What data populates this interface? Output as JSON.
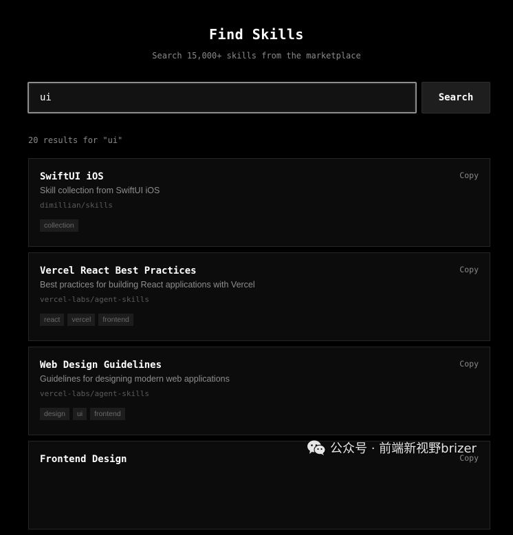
{
  "header": {
    "title": "Find Skills",
    "subtitle": "Search 15,000+ skills from the marketplace"
  },
  "search": {
    "value": "ui",
    "button_label": "Search"
  },
  "results_count": "20 results for \"ui\"",
  "results": [
    {
      "title": "SwiftUI iOS",
      "description": "Skill collection from SwiftUI iOS",
      "repo": "dimillian/skills",
      "tags": [
        "collection"
      ],
      "copy_label": "Copy"
    },
    {
      "title": "Vercel React Best Practices",
      "description": "Best practices for building React applications with Vercel",
      "repo": "vercel-labs/agent-skills",
      "tags": [
        "react",
        "vercel",
        "frontend"
      ],
      "copy_label": "Copy"
    },
    {
      "title": "Web Design Guidelines",
      "description": "Guidelines for designing modern web applications",
      "repo": "vercel-labs/agent-skills",
      "tags": [
        "design",
        "ui",
        "frontend"
      ],
      "copy_label": "Copy"
    },
    {
      "title": "Frontend Design",
      "description": "",
      "repo": "",
      "tags": [],
      "copy_label": "Copy"
    }
  ],
  "watermark": {
    "icon": "wechat-icon",
    "text": "公众号 · 前端新视野brizer"
  },
  "colors": {
    "background": "#000000",
    "card_background": "#0c0c0c",
    "card_border": "#262626",
    "muted_text": "#8a8a8a"
  }
}
